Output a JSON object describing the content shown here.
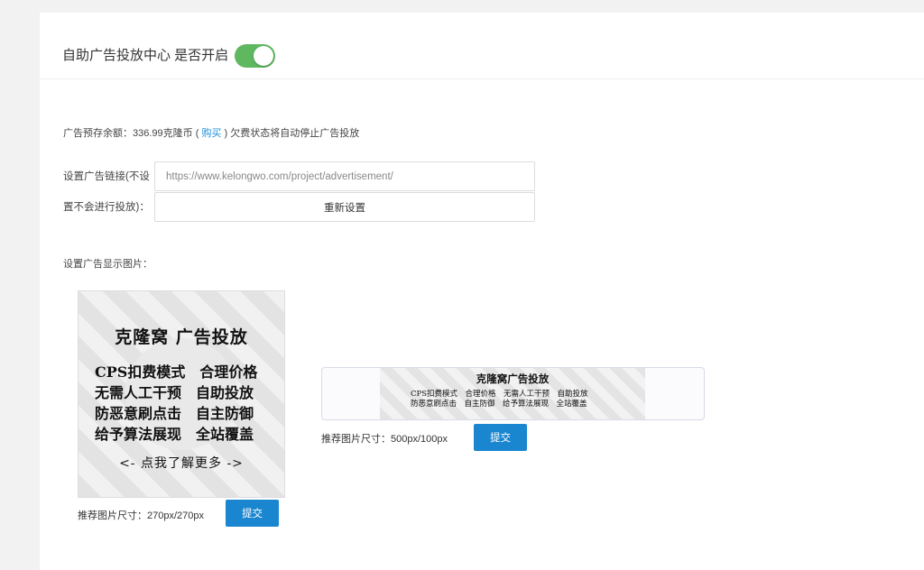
{
  "header": {
    "title": "自助广告投放中心 是否开启",
    "toggle_on": true
  },
  "balance": {
    "prefix": "广告预存余额：336.99克隆币 (",
    "buy_link": "购买",
    "suffix": ") 欠费状态将自动停止广告投放"
  },
  "link": {
    "label_line1": "设置广告链接(不设",
    "label_line2": "置不会进行投放)：",
    "placeholder": "https://www.kelongwo.com/project/advertisement/",
    "reset_label": "重新设置"
  },
  "image_section": {
    "label": "设置广告显示图片："
  },
  "ad_square": {
    "title": "克隆窝 广告投放",
    "lines": [
      "CPS扣费模式　合理价格",
      "无需人工干预　自助投放",
      "防恶意刷点击　自主防御",
      "给予算法展现　全站覆盖"
    ],
    "more": "<- 点我了解更多 ->",
    "size_text": "推荐图片尺寸：270px/270px",
    "submit_label": "提交"
  },
  "ad_banner": {
    "title": "克隆窝广告投放",
    "line1": "CPS扣费模式　合理价格　无需人工干预　自助投放",
    "line2": "防恶意刷点击　自主防御　给予算法展现　全站覆盖",
    "size_text": "推荐图片尺寸：500px/100px",
    "submit_label": "提交"
  },
  "colors": {
    "accent": "#1a86d0",
    "toggle": "#5fb85f",
    "link": "#1e8fd6"
  }
}
